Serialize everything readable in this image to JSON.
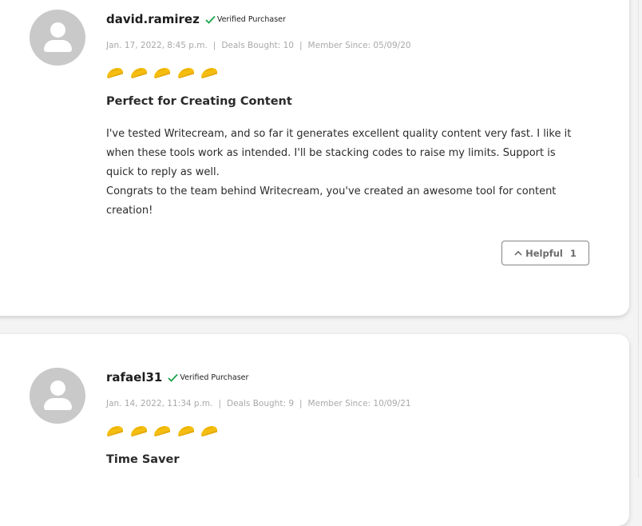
{
  "reviews": [
    {
      "username": "david.ramirez",
      "verified_label": "Verified Purchaser",
      "date": "Jan. 17, 2022, 8:45 p.m.",
      "deals_bought": "Deals Bought: 10",
      "member_since": "Member Since: 05/09/20",
      "rating": 5,
      "rating_icon": "taco-icon",
      "title": "Perfect for Creating Content",
      "body": [
        "I've tested Writecream, and so far it generates excellent quality content very fast. I like it when these tools work as intended. I'll be stacking codes to raise my limits. Support is quick to reply as well.",
        "Congrats to the team behind Writecream, you've created an awesome tool for content creation!"
      ],
      "helpful_label": "Helpful",
      "helpful_count": "1"
    },
    {
      "username": "rafael31",
      "verified_label": "Verified Purchaser",
      "date": "Jan. 14, 2022, 11:34 p.m.",
      "deals_bought": "Deals Bought: 9",
      "member_since": "Member Since: 10/09/21",
      "rating": 5,
      "rating_icon": "taco-icon",
      "title": "Time Saver"
    }
  ],
  "meta_separator": "|",
  "colors": {
    "verified_check": "#1aa34a",
    "taco": "#f5bd0d",
    "avatar_bg": "#c9c9c9",
    "meta_text": "#a9a9a9"
  }
}
